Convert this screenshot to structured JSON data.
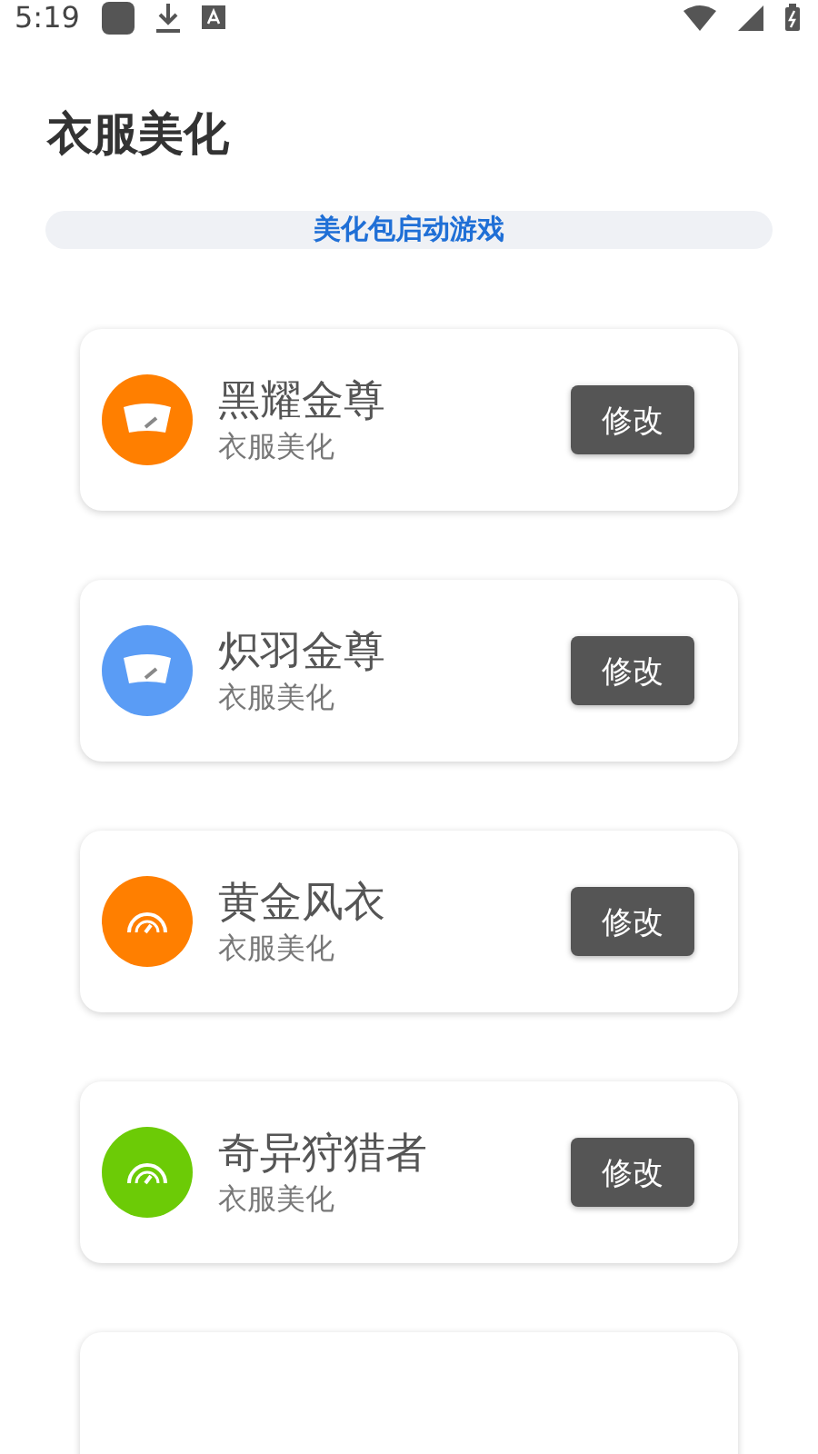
{
  "status_bar": {
    "time": "5:19"
  },
  "title": "衣服美化",
  "launch_button": "美化包启动游戏",
  "items": [
    {
      "name": "黑耀金尊",
      "subtitle": "衣服美化",
      "action": "修改",
      "kind": "windshield",
      "color": "#ff7f00"
    },
    {
      "name": "炽羽金尊",
      "subtitle": "衣服美化",
      "action": "修改",
      "kind": "windshield",
      "color": "#5a9cf5"
    },
    {
      "name": "黄金风衣",
      "subtitle": "衣服美化",
      "action": "修改",
      "kind": "gauge",
      "color": "#ff7f00"
    },
    {
      "name": "奇异狩猎者",
      "subtitle": "衣服美化",
      "action": "修改",
      "kind": "gauge",
      "color": "#6ccb06"
    }
  ]
}
